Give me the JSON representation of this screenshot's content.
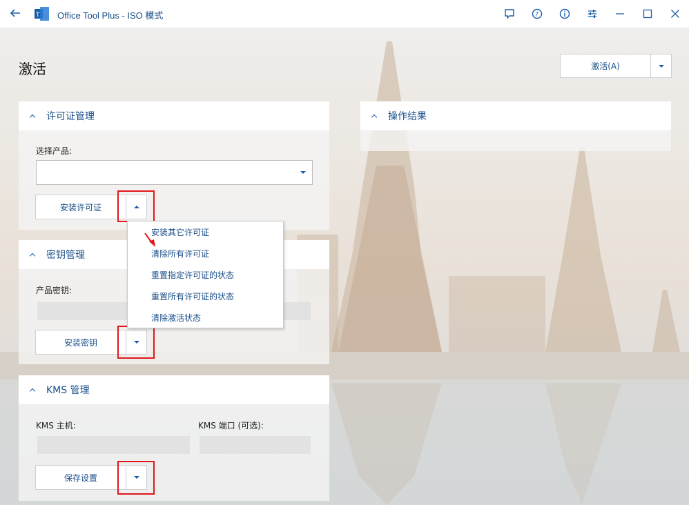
{
  "titlebar": {
    "title": "Office Tool Plus - ISO 模式",
    "icons": [
      "back-arrow-icon",
      "app-logo-icon",
      "feedback-icon",
      "help-icon",
      "info-icon",
      "settings-sliders-icon",
      "minimize-icon",
      "maximize-icon",
      "close-icon"
    ]
  },
  "page": {
    "title": "激活",
    "activate_label": "激活(A)"
  },
  "license": {
    "header": "许可证管理",
    "select_product_label": "选择产品:",
    "product_value": "",
    "install_label": "安装许可证"
  },
  "menu": {
    "items": [
      "安装其它许可证",
      "清除所有许可证",
      "重置指定许可证的状态",
      "重置所有许可证的状态",
      "清除激活状态"
    ]
  },
  "key": {
    "header": "密钥管理",
    "product_key_label": "产品密钥:",
    "product_key_value": "",
    "install_label": "安装密钥"
  },
  "kms": {
    "header": "KMS 管理",
    "host_label": "KMS 主机:",
    "host_value": "",
    "port_label": "KMS 端口 (可选):",
    "port_value": "",
    "save_label": "保存设置"
  },
  "result": {
    "header": "操作结果"
  },
  "colors": {
    "accent": "#1a5ea8",
    "text_blue": "#1a4f8a",
    "highlight_red": "#e0161b"
  }
}
